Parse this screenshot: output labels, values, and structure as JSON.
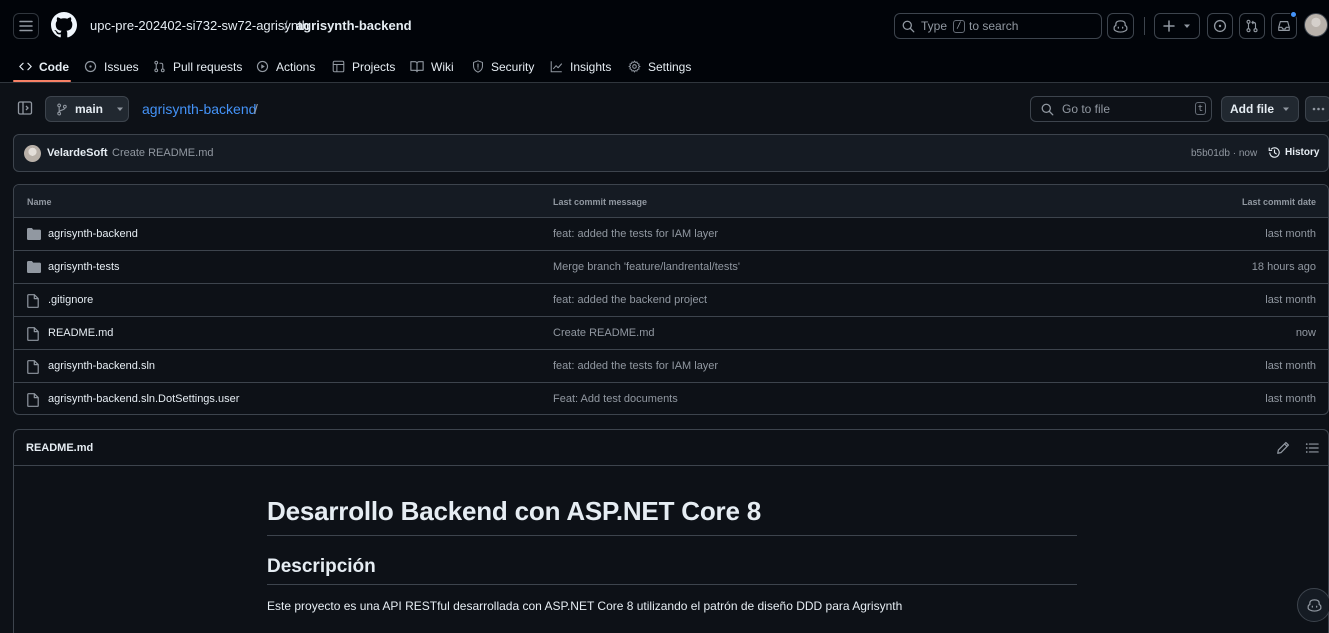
{
  "header": {
    "owner": "upc-pre-202402-si732-sw72-agrisynth",
    "separator": "/",
    "repo": "agrisynth-backend",
    "search": {
      "prefix": "Type",
      "key": "/",
      "suffix": "to search"
    }
  },
  "tabs": [
    {
      "label": "Code",
      "icon": "code-icon",
      "active": true
    },
    {
      "label": "Issues",
      "icon": "issue-opened-icon"
    },
    {
      "label": "Pull requests",
      "icon": "git-pull-request-icon"
    },
    {
      "label": "Actions",
      "icon": "play-icon"
    },
    {
      "label": "Projects",
      "icon": "table-icon"
    },
    {
      "label": "Wiki",
      "icon": "book-icon"
    },
    {
      "label": "Security",
      "icon": "shield-icon"
    },
    {
      "label": "Insights",
      "icon": "graph-icon"
    },
    {
      "label": "Settings",
      "icon": "gear-icon"
    }
  ],
  "toolbar": {
    "branch": "main",
    "path_repo": "agrisynth-backend",
    "path_sep": "/",
    "goto_placeholder": "Go to file",
    "goto_key": "t",
    "add_file": "Add file"
  },
  "latest_commit": {
    "author": "VelardeSoft",
    "message": "Create README.md",
    "sha_time": "b5b01db · now",
    "history": "History"
  },
  "file_table": {
    "headers": {
      "name": "Name",
      "message": "Last commit message",
      "date": "Last commit date"
    },
    "rows": [
      {
        "type": "folder",
        "name": "agrisynth-backend",
        "message": "feat: added the tests for IAM layer",
        "date": "last month"
      },
      {
        "type": "folder",
        "name": "agrisynth-tests",
        "message": "Merge branch 'feature/landrental/tests'",
        "date": "18 hours ago"
      },
      {
        "type": "file",
        "name": ".gitignore",
        "message": "feat: added the backend project",
        "date": "last month"
      },
      {
        "type": "file",
        "name": "README.md",
        "message": "Create README.md",
        "date": "now"
      },
      {
        "type": "file",
        "name": "agrisynth-backend.sln",
        "message": "feat: added the tests for IAM layer",
        "date": "last month"
      },
      {
        "type": "file",
        "name": "agrisynth-backend.sln.DotSettings.user",
        "message": "Feat: Add test documents",
        "date": "last month"
      }
    ]
  },
  "readme": {
    "title": "README.md",
    "h1": "Desarrollo Backend con ASP.NET Core 8",
    "h2": "Descripción",
    "paragraph": "Este proyecto es una API RESTful desarrollada con ASP.NET Core 8 utilizando el patrón de diseño DDD para Agrisynth"
  },
  "colors": {
    "accent_link": "#4493f8",
    "tab_underline": "#f78166",
    "notification": "#4493f8"
  }
}
